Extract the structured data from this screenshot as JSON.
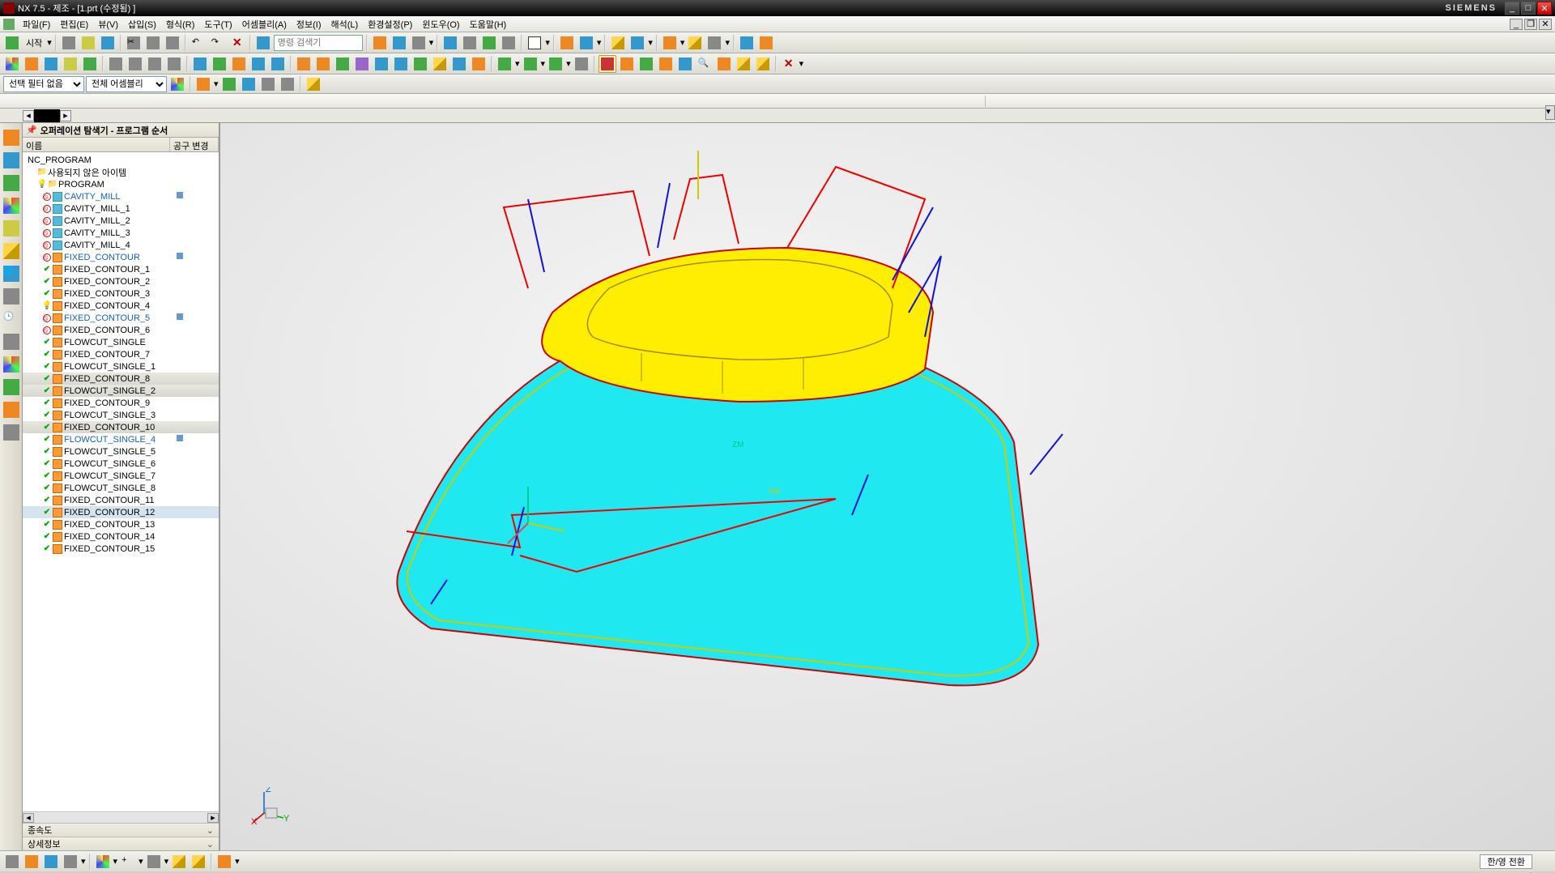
{
  "titlebar": {
    "text": "NX 7.5 - 제조 - [1.prt (수정됨) ]",
    "brand": "SIEMENS"
  },
  "menu": {
    "items": [
      "파일(F)",
      "편집(E)",
      "뷰(V)",
      "삽입(S)",
      "형식(R)",
      "도구(T)",
      "어셈블리(A)",
      "정보(I)",
      "해석(L)",
      "환경설정(P)",
      "윈도우(O)",
      "도움말(H)"
    ]
  },
  "toolbar1": {
    "start": "시작",
    "search_label": "명령 검색기"
  },
  "selbar": {
    "filter": "선택 필터 없음",
    "assembly": "전체 어셈블리"
  },
  "nav": {
    "title": "오퍼레이션 탐색기 - 프로그램 순서",
    "col1": "이름",
    "col2": "공구 변경",
    "root": "NC_PROGRAM",
    "unused": "사용되지 않은 아이템",
    "program": "PROGRAM",
    "footer1": "종속도",
    "footer2": "상세정보"
  },
  "tree": [
    {
      "n": "CAVITY_MILL",
      "s": "forbid",
      "link": true,
      "tc": true
    },
    {
      "n": "CAVITY_MILL_1",
      "s": "forbid"
    },
    {
      "n": "CAVITY_MILL_2",
      "s": "forbid"
    },
    {
      "n": "CAVITY_MILL_3",
      "s": "forbid"
    },
    {
      "n": "CAVITY_MILL_4",
      "s": "forbid"
    },
    {
      "n": "FIXED_CONTOUR",
      "s": "forbid",
      "link": true,
      "oc": "o",
      "tc": true
    },
    {
      "n": "FIXED_CONTOUR_1",
      "s": "check",
      "oc": "o"
    },
    {
      "n": "FIXED_CONTOUR_2",
      "s": "check",
      "oc": "o"
    },
    {
      "n": "FIXED_CONTOUR_3",
      "s": "check",
      "oc": "o"
    },
    {
      "n": "FIXED_CONTOUR_4",
      "s": "bulb",
      "oc": "o"
    },
    {
      "n": "FIXED_CONTOUR_5",
      "s": "forbid",
      "link": true,
      "oc": "o",
      "tc": true
    },
    {
      "n": "FIXED_CONTOUR_6",
      "s": "forbid",
      "oc": "o"
    },
    {
      "n": "FLOWCUT_SINGLE",
      "s": "check",
      "oc": "o"
    },
    {
      "n": "FIXED_CONTOUR_7",
      "s": "check",
      "oc": "o"
    },
    {
      "n": "FLOWCUT_SINGLE_1",
      "s": "check",
      "oc": "o"
    },
    {
      "n": "FIXED_CONTOUR_8",
      "s": "check",
      "oc": "o",
      "sel": true
    },
    {
      "n": "FLOWCUT_SINGLE_2",
      "s": "check",
      "oc": "o",
      "sel": true
    },
    {
      "n": "FIXED_CONTOUR_9",
      "s": "check",
      "oc": "o"
    },
    {
      "n": "FLOWCUT_SINGLE_3",
      "s": "check",
      "oc": "o"
    },
    {
      "n": "FIXED_CONTOUR_10",
      "s": "check",
      "oc": "o",
      "sel": true
    },
    {
      "n": "FLOWCUT_SINGLE_4",
      "s": "check",
      "link": true,
      "oc": "o",
      "tc": true
    },
    {
      "n": "FLOWCUT_SINGLE_5",
      "s": "check",
      "oc": "o"
    },
    {
      "n": "FLOWCUT_SINGLE_6",
      "s": "check",
      "oc": "o"
    },
    {
      "n": "FLOWCUT_SINGLE_7",
      "s": "check",
      "oc": "o"
    },
    {
      "n": "FLOWCUT_SINGLE_8",
      "s": "check",
      "oc": "o"
    },
    {
      "n": "FIXED_CONTOUR_11",
      "s": "check",
      "oc": "o"
    },
    {
      "n": "FIXED_CONTOUR_12",
      "s": "check",
      "oc": "o",
      "sel": true,
      "hl": true
    },
    {
      "n": "FIXED_CONTOUR_13",
      "s": "check",
      "oc": "o"
    },
    {
      "n": "FIXED_CONTOUR_14",
      "s": "check",
      "oc": "o"
    },
    {
      "n": "FIXED_CONTOUR_15",
      "s": "check",
      "oc": "o"
    }
  ],
  "viewport": {
    "zm": "ZM",
    "ym": "YM"
  },
  "status": {
    "ime": "한/영 전환"
  }
}
